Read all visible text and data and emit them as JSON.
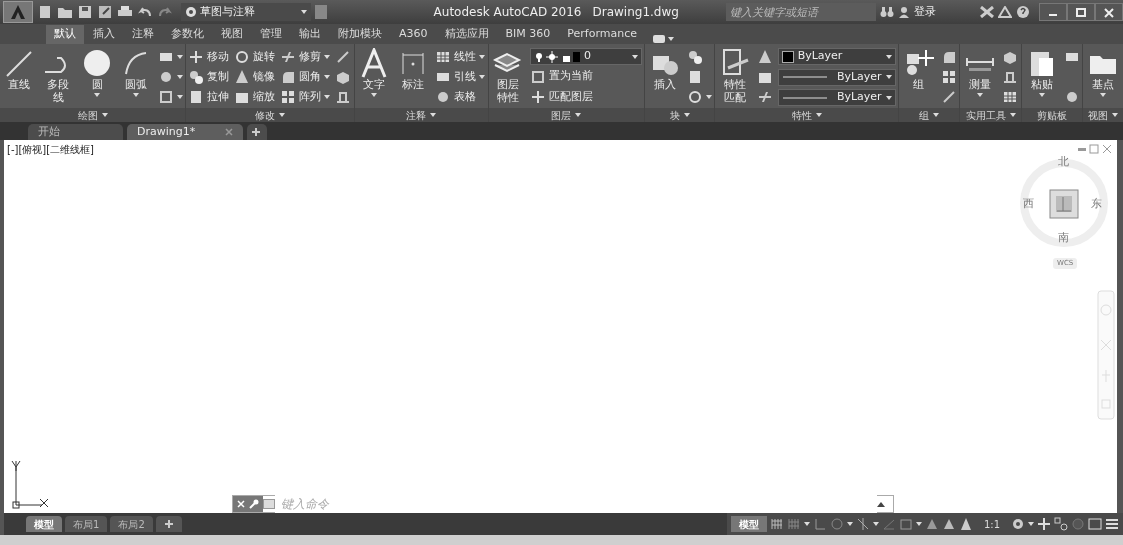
{
  "title_bar": {
    "workspace": "草图与注释",
    "app_title": "Autodesk AutoCAD 2016",
    "file_name": "Drawing1.dwg",
    "search_placeholder": "键入关键字或短语",
    "login": "登录"
  },
  "ribbon_tabs": [
    {
      "label": "默认",
      "selected": true
    },
    {
      "label": "插入",
      "selected": false
    },
    {
      "label": "注释",
      "selected": false
    },
    {
      "label": "参数化",
      "selected": false
    },
    {
      "label": "视图",
      "selected": false
    },
    {
      "label": "管理",
      "selected": false
    },
    {
      "label": "输出",
      "selected": false
    },
    {
      "label": "附加模块",
      "selected": false
    },
    {
      "label": "A360",
      "selected": false
    },
    {
      "label": "精选应用",
      "selected": false
    },
    {
      "label": "BIM 360",
      "selected": false
    },
    {
      "label": "Performance",
      "selected": false
    }
  ],
  "panels": [
    {
      "title": "绘图",
      "dropdown": true,
      "columns": [
        [
          {
            "kind": "large",
            "label": "直线",
            "dropdown": false
          }
        ],
        [
          {
            "kind": "large",
            "label": "多段线",
            "dropdown": false
          }
        ],
        [
          {
            "kind": "large",
            "label": "圆",
            "dropdown": true
          }
        ],
        [
          {
            "kind": "large",
            "label": "圆弧",
            "dropdown": true
          }
        ],
        [
          {
            "kind": "icon",
            "dropdown": true
          },
          {
            "kind": "icon",
            "dropdown": true
          },
          {
            "kind": "icon",
            "dropdown": true
          }
        ]
      ]
    },
    {
      "title": "修改",
      "dropdown": true,
      "columns": [
        [
          {
            "kind": "small",
            "label": "移动",
            "dropdown": false
          },
          {
            "kind": "small",
            "label": "复制",
            "dropdown": false
          },
          {
            "kind": "small",
            "label": "拉伸",
            "dropdown": false
          }
        ],
        [
          {
            "kind": "small",
            "label": "旋转",
            "dropdown": false
          },
          {
            "kind": "small",
            "label": "镜像",
            "dropdown": false
          },
          {
            "kind": "small",
            "label": "缩放",
            "dropdown": false
          }
        ],
        [
          {
            "kind": "small",
            "label": "修剪",
            "dropdown": true
          },
          {
            "kind": "small",
            "label": "圆角",
            "dropdown": true
          },
          {
            "kind": "small",
            "label": "阵列",
            "dropdown": true
          }
        ],
        [
          {
            "kind": "icon",
            "dropdown": false
          },
          {
            "kind": "icon",
            "dropdown": false
          },
          {
            "kind": "icon",
            "dropdown": false
          }
        ]
      ]
    },
    {
      "title": "注释",
      "dropdown": true,
      "columns": [
        [
          {
            "kind": "large",
            "label": "文字",
            "dropdown": true
          }
        ],
        [
          {
            "kind": "large",
            "label": "标注",
            "dropdown": false
          }
        ],
        [
          {
            "kind": "small",
            "label": "线性",
            "dropdown": true
          },
          {
            "kind": "small",
            "label": "引线",
            "dropdown": true
          },
          {
            "kind": "small",
            "label": "表格",
            "dropdown": false
          }
        ]
      ]
    },
    {
      "title": "图层",
      "dropdown": true,
      "columns": [
        [
          {
            "kind": "large",
            "label": "图层特性",
            "dropdown": false
          }
        ],
        [
          {
            "kind": "combo",
            "value": "0"
          },
          {
            "kind": "small",
            "label": "置为当前",
            "dropdown": false
          },
          {
            "kind": "small",
            "label": "匹配图层",
            "dropdown": false
          }
        ]
      ]
    },
    {
      "title": "块",
      "dropdown": true,
      "columns": [
        [
          {
            "kind": "large",
            "label": "插入",
            "dropdown": false
          }
        ],
        [
          {
            "kind": "icon",
            "dropdown": false
          },
          {
            "kind": "icon",
            "dropdown": false
          },
          {
            "kind": "icon",
            "dropdown": true
          }
        ]
      ]
    },
    {
      "title": "特性",
      "dropdown": true,
      "columns": [
        [
          {
            "kind": "large",
            "label": "特性匹配",
            "dropdown": false
          }
        ],
        [
          {
            "kind": "icon",
            "dropdown": false
          },
          {
            "kind": "icon",
            "dropdown": false
          },
          {
            "kind": "icon",
            "dropdown": false
          }
        ],
        [
          {
            "kind": "color-combo",
            "value": "ByLayer"
          },
          {
            "kind": "line-combo",
            "value": "ByLayer"
          },
          {
            "kind": "line-combo",
            "value": "ByLayer"
          }
        ]
      ]
    },
    {
      "title": "组",
      "dropdown": true,
      "columns": [
        [
          {
            "kind": "large",
            "label": "组",
            "dropdown": false
          }
        ],
        [
          {
            "kind": "icon",
            "dropdown": false
          },
          {
            "kind": "icon",
            "dropdown": false
          },
          {
            "kind": "icon",
            "dropdown": false
          }
        ]
      ]
    },
    {
      "title": "实用工具",
      "dropdown": true,
      "columns": [
        [
          {
            "kind": "large",
            "label": "测量",
            "dropdown": true
          }
        ],
        [
          {
            "kind": "icon",
            "dropdown": false
          },
          {
            "kind": "icon",
            "dropdown": false
          },
          {
            "kind": "icon",
            "dropdown": false
          }
        ]
      ]
    },
    {
      "title": "剪贴板",
      "dropdown": false,
      "columns": [
        [
          {
            "kind": "large",
            "label": "粘贴",
            "dropdown": true
          }
        ],
        [
          {
            "kind": "icon",
            "dropdown": false
          },
          {
            "kind": "icon",
            "dropdown": false
          }
        ]
      ]
    },
    {
      "title": "视图",
      "dropdown": true,
      "columns": [
        [
          {
            "kind": "large",
            "label": "基点",
            "dropdown": true
          }
        ]
      ]
    }
  ],
  "file_tabs": [
    {
      "label": "开始",
      "selected": false,
      "closable": false
    },
    {
      "label": "Drawing1*",
      "selected": true,
      "closable": true
    }
  ],
  "viewport_label": "[-][俯视][二维线框]",
  "viewcube": {
    "north": "北",
    "west": "西",
    "east": "东",
    "south": "南",
    "ucs": "WCS"
  },
  "command_line": {
    "placeholder": "键入命令"
  },
  "layout_tabs": [
    {
      "label": "模型",
      "selected": true
    },
    {
      "label": "布局1",
      "selected": false
    },
    {
      "label": "布局2",
      "selected": false
    }
  ],
  "status_bar": {
    "space": "模型",
    "scale": "1:1"
  }
}
